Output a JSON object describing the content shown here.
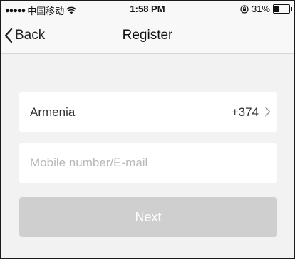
{
  "status_bar": {
    "signal_dots": "●●●●●",
    "carrier": "中国移动",
    "wifi_icon": "wifi-icon",
    "time": "1:58 PM",
    "rotation_lock_icon": "rotation-lock-icon",
    "battery_text": "31%",
    "battery_level": 0.31
  },
  "nav": {
    "back_label": "Back",
    "title": "Register"
  },
  "form": {
    "country_name": "Armenia",
    "country_code": "+374",
    "contact_value": "",
    "contact_placeholder": "Mobile number/E-mail",
    "next_label": "Next"
  },
  "colors": {
    "background": "#f2f2f2",
    "card": "#ffffff",
    "button_disabled": "#cfcfcf",
    "placeholder": "#b8b8b8"
  }
}
